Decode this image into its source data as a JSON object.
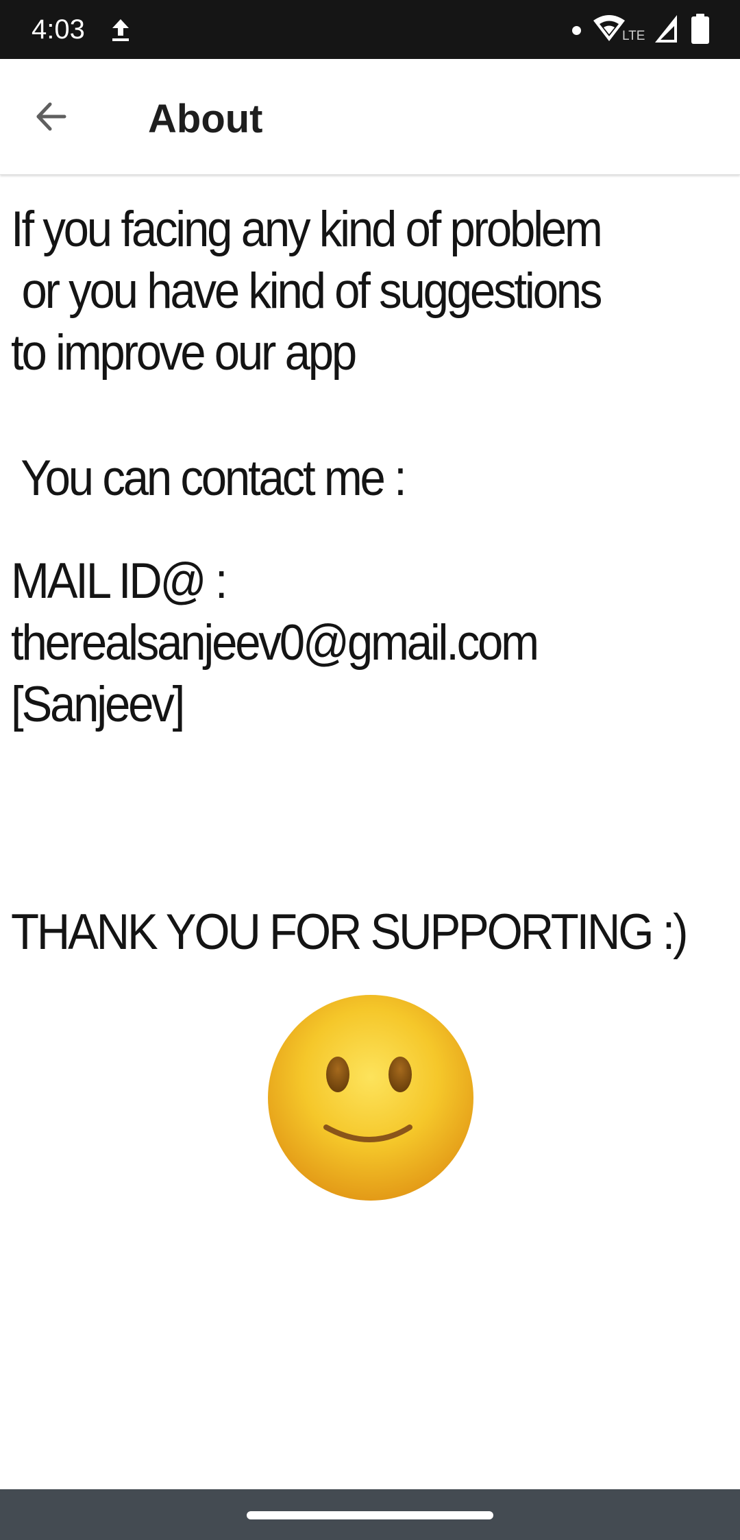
{
  "status_bar": {
    "time": "4:03",
    "network_label": "LTE",
    "icons": [
      "upload-icon",
      "wifi-icon",
      "signal-icon",
      "battery-icon"
    ]
  },
  "app_bar": {
    "back_icon": "arrow-left-icon",
    "title": "About"
  },
  "content": {
    "intro_lines": [
      "If you facing any kind of problem",
      " or you have kind of suggestions",
      "to improve our app"
    ],
    "contact_line": " You can contact me :",
    "mail_lines": [
      "MAIL ID@ :",
      "therealsanjeev0@gmail.com",
      "[Sanjeev]"
    ],
    "thanks_line": "THANK YOU FOR SUPPORTING :)",
    "emoji": "slightly-smiling-face-icon"
  },
  "colors": {
    "status_bar_bg": "#151515",
    "nav_bar_bg": "#444b52",
    "text": "#141414",
    "emoji_yellow": "#f5c72a"
  }
}
